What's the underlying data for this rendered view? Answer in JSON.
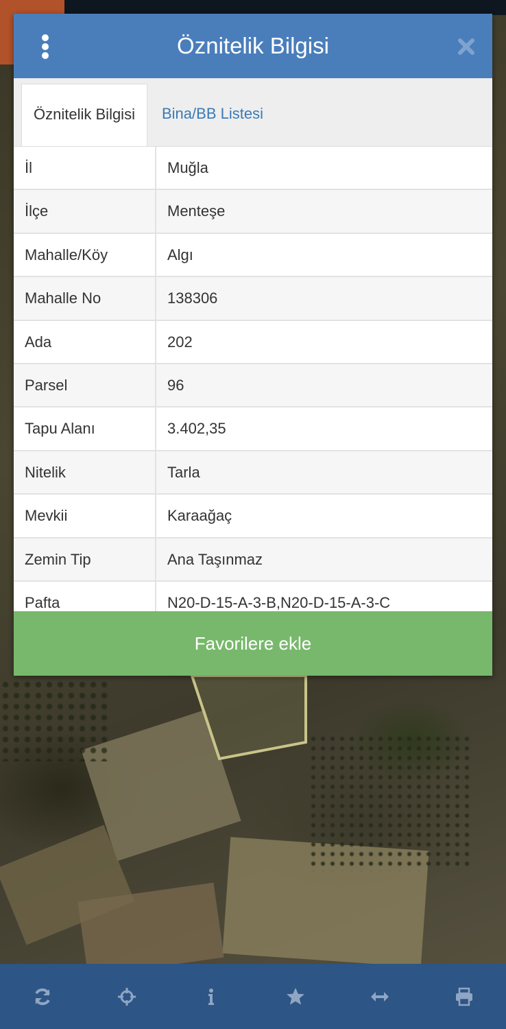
{
  "popup": {
    "title": "Öznitelik Bilgisi",
    "menu_icon": "vertical-dots-icon",
    "close_icon": "close-icon",
    "header_color": "#4a7ebb"
  },
  "tabs": [
    {
      "label": "Öznitelik Bilgisi",
      "active": true
    },
    {
      "label": "Bina/BB Listesi",
      "active": false
    }
  ],
  "attributes": [
    {
      "key": "İl",
      "value": "Muğla"
    },
    {
      "key": "İlçe",
      "value": "Menteşe"
    },
    {
      "key": "Mahalle/Köy",
      "value": "Algı"
    },
    {
      "key": "Mahalle No",
      "value": "138306"
    },
    {
      "key": "Ada",
      "value": "202"
    },
    {
      "key": "Parsel",
      "value": "96"
    },
    {
      "key": "Tapu Alanı",
      "value": "3.402,35"
    },
    {
      "key": "Nitelik",
      "value": "Tarla"
    },
    {
      "key": "Mevkii",
      "value": "Karaağaç"
    },
    {
      "key": "Zemin Tip",
      "value": "Ana Taşınmaz"
    },
    {
      "key": "Pafta",
      "value": "N20-D-15-A-3-B,N20-D-15-A-3-C"
    }
  ],
  "favorite_button": {
    "label": "Favorilere ekle",
    "color": "#78b86c"
  },
  "toolbar": {
    "color": "#2d5585",
    "items": [
      {
        "icon": "refresh-icon"
      },
      {
        "icon": "crosshair-icon"
      },
      {
        "icon": "info-icon"
      },
      {
        "icon": "star-icon"
      },
      {
        "icon": "horizontal-arrows-icon"
      },
      {
        "icon": "print-icon"
      }
    ]
  }
}
